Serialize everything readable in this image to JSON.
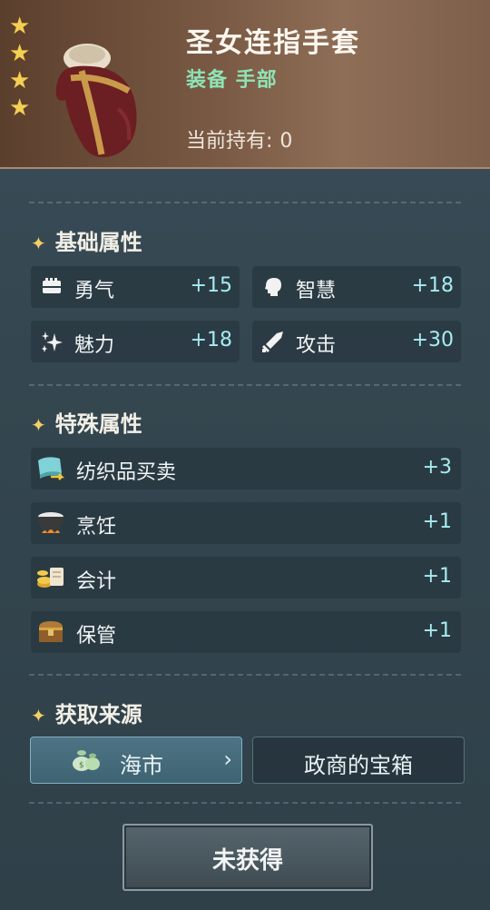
{
  "item": {
    "name": "圣女连指手套",
    "category": "装备  手部",
    "holding_label": "当前持有:",
    "holding_value": "0",
    "stars": 4,
    "star_color": "#f3cf55"
  },
  "basic": {
    "title": "基础属性",
    "stats": [
      {
        "label": "勇气",
        "value": "+15",
        "icon": "fist-icon"
      },
      {
        "label": "智慧",
        "value": "+18",
        "icon": "head-icon"
      },
      {
        "label": "魅力",
        "value": "+18",
        "icon": "sparkle-icon"
      },
      {
        "label": "攻击",
        "value": "+30",
        "icon": "sword-icon"
      }
    ]
  },
  "special": {
    "title": "特殊属性",
    "rows": [
      {
        "label": "纺织品买卖",
        "value": "+3",
        "icon": "cloth-trade-icon"
      },
      {
        "label": "烹饪",
        "value": "+1",
        "icon": "cooking-pot-icon"
      },
      {
        "label": "会计",
        "value": "+1",
        "icon": "coins-scroll-icon"
      },
      {
        "label": "保管",
        "value": "+1",
        "icon": "chest-icon"
      }
    ]
  },
  "source": {
    "title": "获取来源",
    "buttons": [
      {
        "label": "海市",
        "icon": "money-bag-icon"
      },
      {
        "label": "政商的宝箱"
      }
    ]
  },
  "action": {
    "label": "未获得"
  },
  "colors": {
    "accent": "#a6ecf1",
    "category": "#8fe3b5",
    "header_bg": "#7a5a44"
  }
}
